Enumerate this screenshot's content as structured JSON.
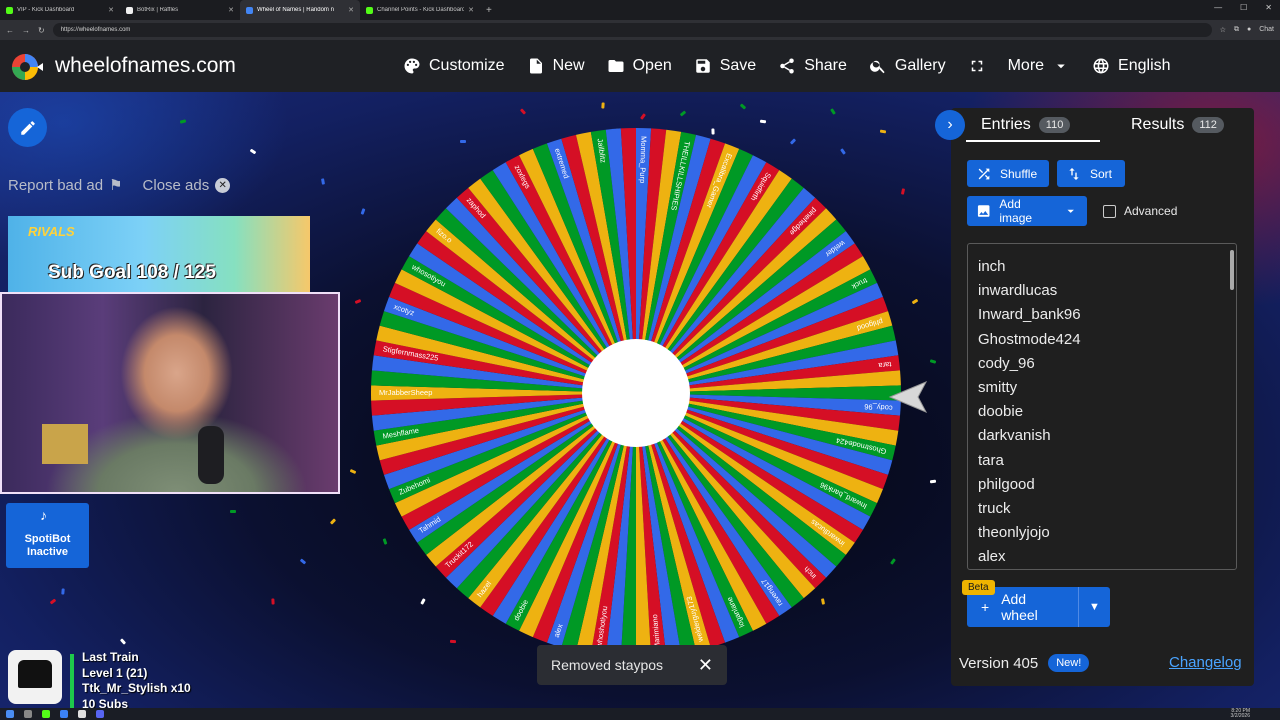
{
  "browser": {
    "tabs": [
      {
        "title": "VIP - Kick Dashboard",
        "color": "#53fc18"
      },
      {
        "title": "BotRix | Raffles",
        "color": "#f0f0f0"
      },
      {
        "title": "Wheel of Names | Random n",
        "color": "#4285f4",
        "active": true
      },
      {
        "title": "Channel Points - Kick Dashboard",
        "color": "#53fc18"
      }
    ],
    "url": "https://wheelofnames.com",
    "chat_label": "Chat"
  },
  "header": {
    "site_name": "wheelofnames.com",
    "nav": [
      {
        "label": "Customize",
        "icon": "palette-icon"
      },
      {
        "label": "New",
        "icon": "file-icon"
      },
      {
        "label": "Open",
        "icon": "folder-icon"
      },
      {
        "label": "Save",
        "icon": "save-icon"
      },
      {
        "label": "Share",
        "icon": "share-icon"
      },
      {
        "label": "Gallery",
        "icon": "search-icon"
      },
      {
        "label": "",
        "icon": "fullscreen-icon"
      },
      {
        "label": "More",
        "icon": "chevron-down-icon"
      },
      {
        "label": "English",
        "icon": "globe-icon"
      }
    ]
  },
  "ads": {
    "report_label": "Report bad ad",
    "close_label": "Close ads",
    "ad_brand": "RIVALS",
    "sub_goal": "Sub Goal  108 / 125"
  },
  "overlay": {
    "spotibot": {
      "line1": "SpotiBot",
      "line2": "Inactive"
    },
    "train": {
      "title": "Last Train",
      "level": "Level 1  (21)",
      "top": "Ttk_Mr_Stylish x10",
      "subs": "10 Subs"
    }
  },
  "wheel": {
    "colors": [
      "#3369e8",
      "#d50f25",
      "#eeb211",
      "#009925"
    ],
    "segments": 110,
    "visible_labels": [
      "Momma_Purp",
      "THEILLKILLSHIPIES",
      "Excalibra_Gamer",
      "Squidfirth",
      "pinehedge",
      "welder",
      "truck",
      "phlgood",
      "tara",
      "cody_96",
      "Ghostmode424",
      "Inward_bank96",
      "inwardlucas",
      "inch",
      "raveng17",
      "loganlane",
      "welderguy173",
      "Marimiano",
      "whoshotiyou",
      "alex",
      "doobie",
      "hazel",
      "Truckit172",
      "Tahmid",
      "Zubehomi",
      "Meshflame",
      "MrJabberSheep",
      "Stigfernmass225",
      "xcotyz",
      "whosotiyou",
      "fizo.o",
      "zaphod",
      "zoxlegs",
      "extremed",
      "Jailblitz"
    ]
  },
  "toast": {
    "message": "Removed staypos",
    "close": "✕"
  },
  "panel": {
    "entries_tab": "Entries",
    "entries_count": "110",
    "results_tab": "Results",
    "results_count": "112",
    "shuffle_label": "Shuffle",
    "sort_label": "Sort",
    "add_image_label": "Add image",
    "advanced_label": "Advanced",
    "entries": [
      "inch",
      "inwardlucas",
      "Inward_bank96",
      "Ghostmode424",
      "cody_96",
      "smitty",
      "doobie",
      "darkvanish",
      "tara",
      "philgood",
      "truck",
      "theonlyjojo",
      "alex"
    ],
    "beta_label": "Beta",
    "add_wheel_label": "Add wheel",
    "version_label": "Version 405",
    "new_label": "New!",
    "changelog_label": "Changelog"
  },
  "taskbar": {
    "time": "8:20 PM",
    "date": "3/2/2026"
  }
}
